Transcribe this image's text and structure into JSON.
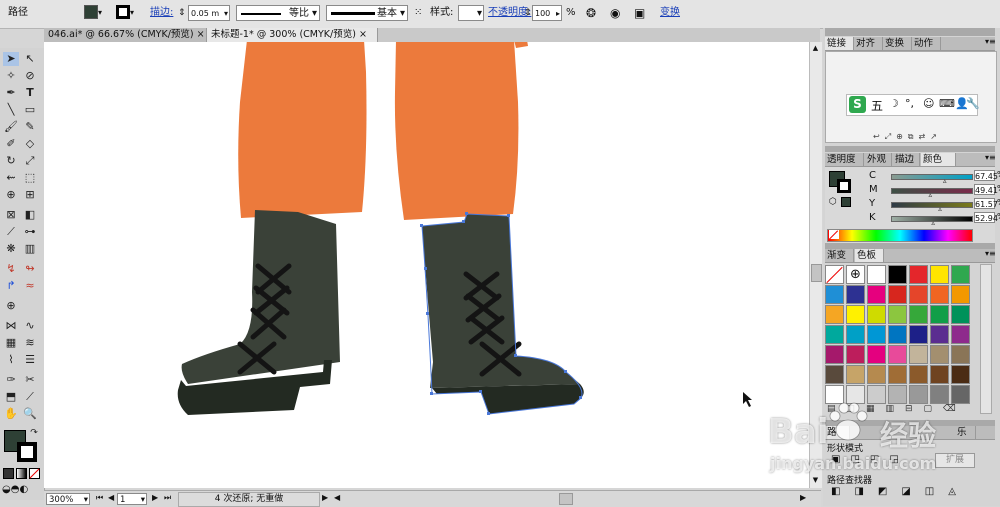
{
  "control_bar": {
    "object_type": "路径",
    "stroke_label": "描边:",
    "stroke_weight": "0.05 m",
    "profile_label": "等比",
    "brush_label": "基本",
    "style_label": "样式:",
    "opacity_label": "不透明度:",
    "opacity_value": "100",
    "opacity_unit": "%",
    "transform_label": "变换"
  },
  "doc_tabs": [
    {
      "label": "046.ai* @ 66.67% (CMYK/预览)",
      "close": "×"
    },
    {
      "label": "未标题-1* @ 300% (CMYK/预览)",
      "close": "×"
    }
  ],
  "panels": {
    "top_tabs": [
      "链接",
      "对齐",
      "变换",
      "动作"
    ],
    "ime_text": "五",
    "color_tabs": [
      "透明度",
      "外观",
      "描边",
      "颜色"
    ],
    "cmyk": [
      {
        "channel": "C",
        "value": "67.45",
        "fraction": 0.6745
      },
      {
        "channel": "M",
        "value": "49.41",
        "fraction": 0.4941
      },
      {
        "channel": "Y",
        "value": "61.57",
        "fraction": 0.6157
      },
      {
        "channel": "K",
        "value": "52.94",
        "fraction": 0.5294
      }
    ],
    "swatch_tabs": [
      "渐变",
      "色板"
    ],
    "swatches": [
      "none",
      "reg",
      "#ffffff",
      "#000000",
      "#e4262b",
      "#ffe500",
      "#2fa84f",
      "#1f8fd6",
      "#2d3192",
      "#e6007e",
      "#d7261e",
      "#e5452a",
      "#f16522",
      "#f39800",
      "#f5a623",
      "#fff100",
      "#cfdb00",
      "#8cc63f",
      "#36a83a",
      "#119e48",
      "#00925a",
      "#00a99d",
      "#00a0c6",
      "#0097d5",
      "#0075c1",
      "#1d2088",
      "#5b2d90",
      "#8e2a8c",
      "#a5196b",
      "#bd1e5c",
      "#e4007f",
      "#e84a9a",
      "#c2b49b",
      "#a38f6f",
      "#8a7557",
      "#594a3c",
      "#c6a468",
      "#b58a4f",
      "#a06d36",
      "#8b5a2b",
      "#6f4320",
      "#4b2c14",
      "#ffffff",
      "#e6e6e6",
      "#cccccc",
      "#b3b3b3",
      "#999999",
      "#808080",
      "#666666"
    ],
    "bottom_tabs": [
      "路",
      "乐"
    ],
    "bottom_label": "路径查找器",
    "bottom_label2": "形状模式",
    "expand_label": "扩展"
  },
  "status_bar": {
    "zoom": "300%",
    "page": "1",
    "history": "4 次还原; 无重做"
  },
  "watermark": {
    "line1": "Bai",
    "line2": "经验",
    "line3": "jingyan.baidu.com"
  },
  "colors": {
    "pants": "#ec7a3c",
    "boot": "#3a4138",
    "sole": "#232a22",
    "lace": "#141414",
    "selection": "#4a78d9",
    "fill_swatch": "#2e4035"
  }
}
